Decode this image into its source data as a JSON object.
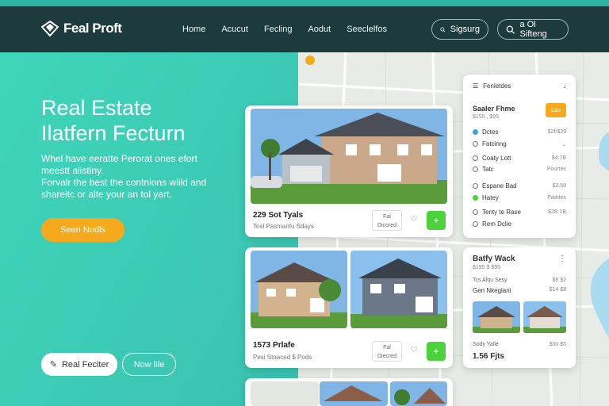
{
  "header": {
    "logo_text": "Feal Proft",
    "nav": [
      "Home",
      "Acucut",
      "Fecling",
      "Aodut",
      "Seeclelfos"
    ],
    "pill_search": "Sigsurg",
    "pill_signin": "a Ol Sifteng"
  },
  "hero": {
    "title_line1": "Real Estate",
    "title_line2": "Ilatfern Fecturn",
    "sub_line1": "Whel have eeratte Perorat ones efort",
    "sub_line2": "meestt alistiny.",
    "sub_line3": "Forvalr the best the contnions wiild and",
    "sub_line4": "shareitc or alte your an tol yart.",
    "cta_label": "Seen Nodls",
    "btn_white_label": "Real Feciter",
    "btn_outline_label": "Now lile"
  },
  "listings": [
    {
      "address": "229 Sot Tyals",
      "sub": "Tosl Pasmanfu Sdays",
      "box": [
        "Fal",
        "Dicored"
      ]
    },
    {
      "address": "1573 Prlafe",
      "sub": "Pesi Stoaced $ Pods",
      "box": [
        "Fal",
        "Diecred"
      ]
    }
  ],
  "filter_panel": {
    "head_label": "Fenletdes",
    "title": "Saaler Fhme",
    "title_sub": "$155 , $95",
    "chip": "Lao",
    "rows": [
      {
        "label": "Dctes",
        "value": "$2f/$29"
      },
      {
        "label": "Fatcinng",
        "value": ""
      },
      {
        "label": "Coaty Lott",
        "value": "$4.7B"
      },
      {
        "label": "Tatc",
        "value": "Pourtes"
      },
      {
        "label": "Espane Bad",
        "value": "$2.58"
      },
      {
        "label": "Hatey",
        "value": "Paddes"
      },
      {
        "label": "Tenty te Rase",
        "value": "$2B 1B"
      },
      {
        "label": "Rem Dclie",
        "value": ""
      }
    ]
  },
  "detail_panel": {
    "title": "Batfy Wack",
    "sub1": "$195 $ $95",
    "sub2": "Tcs Alqu Sesy",
    "sub2_value": "$8 $2",
    "label": "Gen Nkeglani",
    "label_value": "$14 $8",
    "bottom_label": "Sody Yalle",
    "bottom_value": "$50 $5",
    "price": "1.56 Fjts"
  },
  "colors": {
    "accent_green": "#4cd23a",
    "accent_orange": "#f6a91c",
    "header_bg": "#1d3b3c",
    "teal": "#3ed6bb"
  }
}
